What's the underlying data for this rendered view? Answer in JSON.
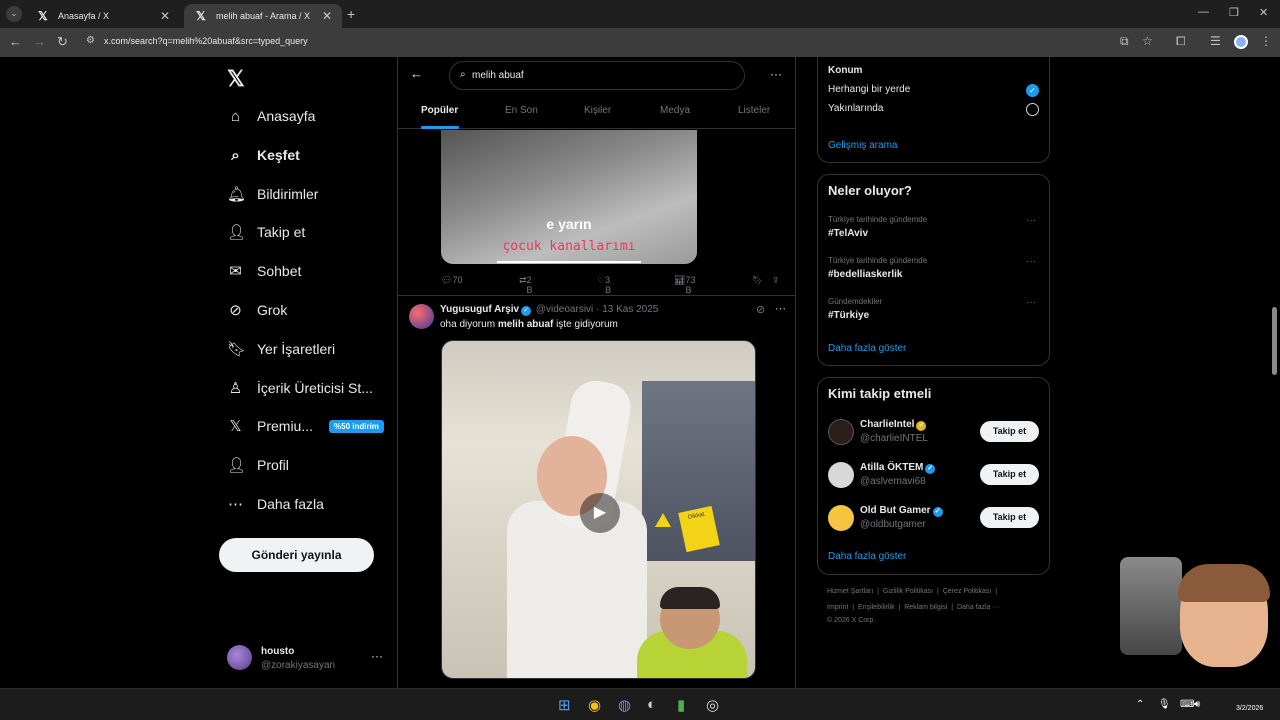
{
  "browser": {
    "tabs": [
      {
        "title": "Anasayfa / X",
        "close": "✕"
      },
      {
        "title": "melih abuaf - Arama / X",
        "close": "✕"
      }
    ],
    "new_tab": "+",
    "url": "x.com/search?q=melih%20abuaf&src=typed_query"
  },
  "sidebar": {
    "logo": "𝕏",
    "items": [
      {
        "label": "Anasayfa",
        "icon": "home-icon",
        "glyph": "⌂"
      },
      {
        "label": "Keşfet",
        "icon": "search-icon",
        "glyph": "⌕"
      },
      {
        "label": "Bildirimler",
        "icon": "bell-icon",
        "glyph": "🔔︎"
      },
      {
        "label": "Takip et",
        "icon": "person-add-icon",
        "glyph": "👤︎"
      },
      {
        "label": "Sohbet",
        "icon": "mail-icon",
        "glyph": "✉"
      },
      {
        "label": "Grok",
        "icon": "grok-icon",
        "glyph": "⊘"
      },
      {
        "label": "Yer İşaretleri",
        "icon": "bookmark-icon",
        "glyph": "🔖︎"
      },
      {
        "label": "İçerik Üreticisi St...",
        "icon": "creator-icon",
        "glyph": "♙"
      },
      {
        "label": "Premiu...",
        "icon": "x-premium-icon",
        "glyph": "𝕏"
      },
      {
        "label": "Profil",
        "icon": "profile-icon",
        "glyph": "👤︎"
      },
      {
        "label": "Daha fazla",
        "icon": "more-circle-icon",
        "glyph": "⋯"
      }
    ],
    "premium_badge": "%50 indirim",
    "post_button": "Gönderi yayınla",
    "account": {
      "name": "housto",
      "handle": "@zorakiyasayan",
      "more": "···"
    }
  },
  "search": {
    "query": "melih abuaf",
    "back": "←",
    "more": "···",
    "tabs": [
      "Popüler",
      "En Son",
      "Kişiler",
      "Medya",
      "Listeler"
    ]
  },
  "tweet1": {
    "caption_line1": "e yarın",
    "caption_line2": "çocuk kanallarımı",
    "replies": "70",
    "reposts": "2 B",
    "likes": "3 B",
    "views": "73 B"
  },
  "tweet2": {
    "author": "Yugusuguf Arşiv",
    "handle": "@videoarsivi",
    "date": "13 Kas 2025",
    "text_before": "oha diyorum ",
    "text_bold": "melih abuaf",
    "text_after": " işte gidiyorum",
    "play": "▶",
    "label": "Dikkat"
  },
  "location": {
    "title": "Konum",
    "options": [
      "Herhangi bir yerde",
      "Yakınlarında"
    ],
    "selected": 0,
    "advanced": "Gelişmiş arama"
  },
  "trends": {
    "title": "Neler oluyor?",
    "items": [
      {
        "context": "Türkiye tarihinde gündemde",
        "tag": "#TelAviv"
      },
      {
        "context": "Türkiye tarihinde gündemde",
        "tag": "#bedelliaskerlik"
      },
      {
        "context": "Gündemdekiler",
        "tag": "#Türkiye"
      }
    ],
    "more": "Daha fazla göster"
  },
  "who_to_follow": {
    "title": "Kimi takip etmeli",
    "accounts": [
      {
        "name": "CharlieIntel",
        "handle": "@charlieINTEL",
        "badge_color": "#e2b719"
      },
      {
        "name": "Atilla ÖKTEM",
        "handle": "@aslvemavi68",
        "badge_color": "#1d9bf0"
      },
      {
        "name": "Old But Gamer",
        "handle": "@oldbutgamer",
        "badge_color": "#1d9bf0"
      }
    ],
    "follow_label": "Takip et",
    "more": "Daha fazla göster"
  },
  "footer": {
    "line1": [
      "Hizmet Şartları",
      "Gizlilik Politikası",
      "Çerez Politikası"
    ],
    "line2": [
      "Imprint",
      "Erişilebilirlik",
      "Reklam bilgisi",
      "Daha fazla ···"
    ],
    "copyright": "© 2026 X Corp."
  },
  "taskbar": {
    "date": "3/2/2026"
  },
  "colors": {
    "accent": "#1d9bf0",
    "background": "#000000",
    "border": "#2f3336"
  }
}
